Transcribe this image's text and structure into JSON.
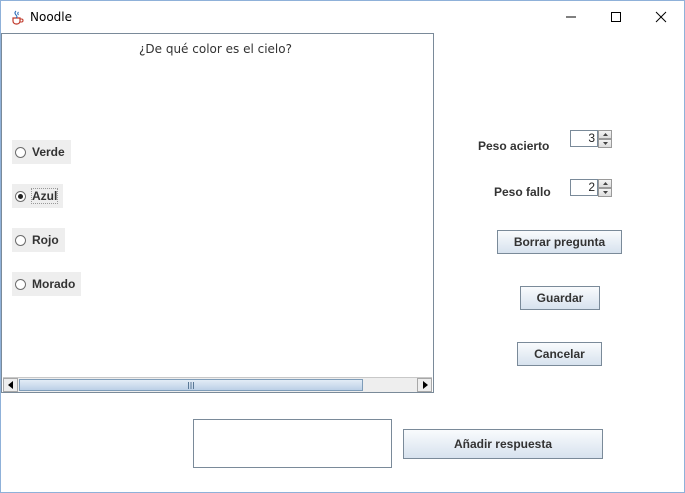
{
  "window": {
    "title": "Noodle",
    "minimize_icon": "minimize-icon",
    "maximize_icon": "maximize-icon",
    "close_icon": "close-icon"
  },
  "question": {
    "text": "¿De qué color es el cielo?"
  },
  "options": [
    {
      "label": "Verde",
      "selected": false
    },
    {
      "label": "Azul",
      "selected": true
    },
    {
      "label": "Rojo",
      "selected": false
    },
    {
      "label": "Morado",
      "selected": false
    }
  ],
  "weights": {
    "correct_label": "Peso acierto",
    "correct_value": "3",
    "wrong_label": "Peso fallo",
    "wrong_value": "2"
  },
  "buttons": {
    "delete_question": "Borrar pregunta",
    "save": "Guardar",
    "cancel": "Cancelar",
    "add_answer": "Añadir respuesta"
  },
  "answer_input": {
    "value": ""
  },
  "colors": {
    "border": "#7a8a99",
    "button_top": "#f9fbfd",
    "button_bottom": "#d7e2ee",
    "option_bg": "#eeeeee"
  }
}
